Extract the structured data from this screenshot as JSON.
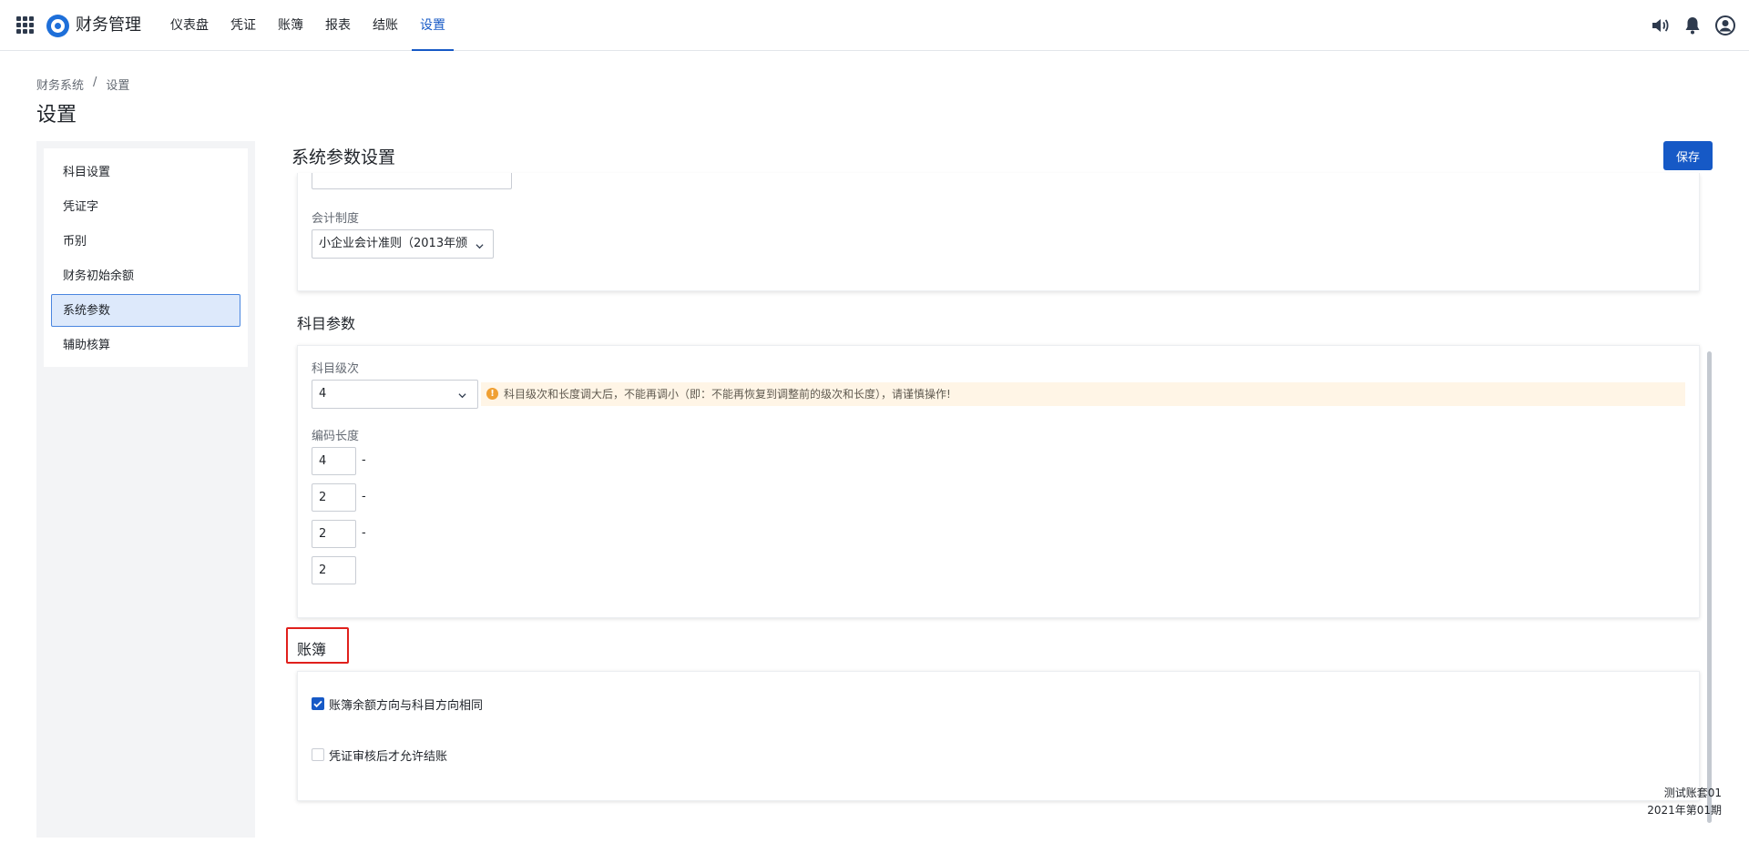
{
  "app": {
    "title": "财务管理",
    "nav": [
      "仪表盘",
      "凭证",
      "账簿",
      "报表",
      "结账",
      "设置"
    ],
    "active_nav": "设置"
  },
  "breadcrumb": {
    "root": "财务系统",
    "separator": "/",
    "current": "设置"
  },
  "page_title": "设置",
  "sidebar": {
    "items": [
      {
        "label": "科目设置"
      },
      {
        "label": "凭证字"
      },
      {
        "label": "币别"
      },
      {
        "label": "财务初始余额"
      },
      {
        "label": "系统参数"
      },
      {
        "label": "辅助核算"
      }
    ],
    "active": "系统参数"
  },
  "main": {
    "title": "系统参数设置",
    "save_label": "保存",
    "accounting": {
      "label": "会计制度",
      "value": "小企业会计准则（2013年颁"
    },
    "subject": {
      "section_title": "科目参数",
      "level_label": "科目级次",
      "level_value": "4",
      "warning": "科目级次和长度调大后，不能再调小（即：不能再恢复到调整前的级次和长度），请谨慎操作!",
      "code_length_label": "编码长度",
      "code_lengths": [
        "4",
        "2",
        "2",
        "2"
      ],
      "separator": "-"
    },
    "ledger": {
      "section_title": "账簿",
      "options": [
        {
          "label": "账簿余额方向与科目方向相同",
          "checked": true
        },
        {
          "label": "凭证审核后才允许结账",
          "checked": false
        }
      ]
    }
  },
  "footer": {
    "account_set": "测试账套01",
    "period": "2021年第01期"
  },
  "colors": {
    "primary": "#1659c6",
    "warning_bg": "#fff5e6",
    "warning_icon": "#f0a033",
    "highlight": "#e0201c"
  }
}
